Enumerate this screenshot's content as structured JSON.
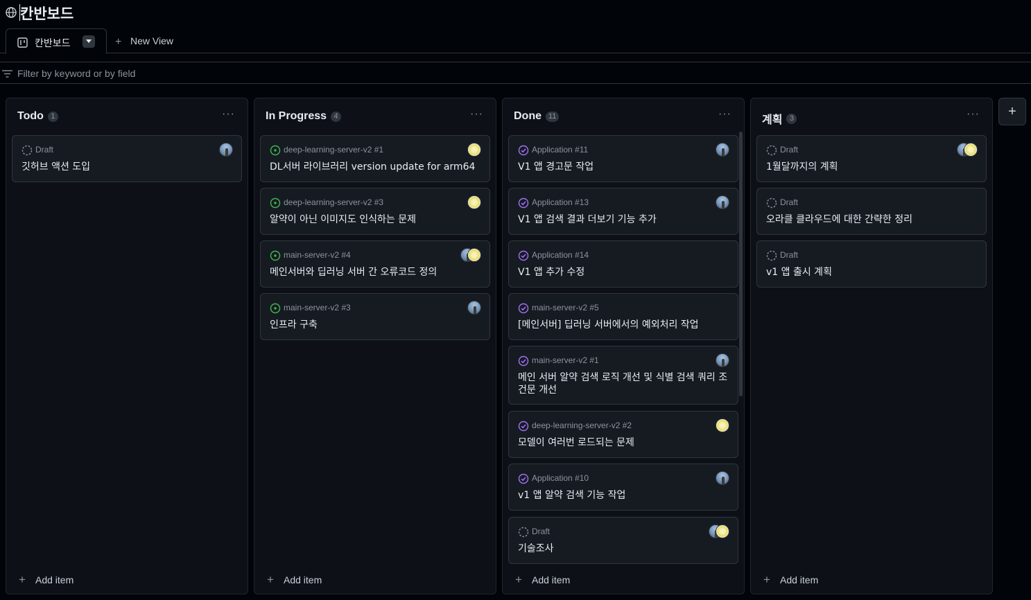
{
  "title": "칸반보드",
  "tabs": {
    "active_label": "칸반보드",
    "new_view_label": "New View"
  },
  "filter": {
    "placeholder": "Filter by keyword or by field"
  },
  "add_item_label": "Add item",
  "columns": [
    {
      "title": "Todo",
      "count": "1",
      "cards": [
        {
          "status": "draft",
          "meta": "Draft",
          "title": "깃허브 액션 도입",
          "avatars": [
            "photo"
          ]
        }
      ]
    },
    {
      "title": "In Progress",
      "count": "4",
      "cards": [
        {
          "status": "open",
          "meta": "deep-learning-server-v2 #1",
          "title": "DL서버 라이브러리 version update for arm64",
          "avatars": [
            "yellow"
          ]
        },
        {
          "status": "open",
          "meta": "deep-learning-server-v2 #3",
          "title": "알약이 아닌 이미지도 인식하는 문제",
          "avatars": [
            "yellow"
          ]
        },
        {
          "status": "open",
          "meta": "main-server-v2 #4",
          "title": "메인서버와 딥러닝 서버 간 오류코드 정의",
          "avatars": [
            "photo",
            "yellow"
          ]
        },
        {
          "status": "open",
          "meta": "main-server-v2 #3",
          "title": "인프라 구축",
          "avatars": [
            "photo"
          ]
        }
      ]
    },
    {
      "title": "Done",
      "count": "11",
      "cards": [
        {
          "status": "done",
          "meta": "Application #11",
          "title": "V1 앱 경고문 작업",
          "avatars": [
            "photo"
          ]
        },
        {
          "status": "done",
          "meta": "Application #13",
          "title": "V1 앱 검색 결과 더보기 기능 추가",
          "avatars": [
            "photo"
          ]
        },
        {
          "status": "done",
          "meta": "Application #14",
          "title": "V1 앱 추가 수정",
          "avatars": []
        },
        {
          "status": "done",
          "meta": "main-server-v2 #5",
          "title": "[메인서버] 딥러닝 서버에서의 예외처리 작업",
          "avatars": []
        },
        {
          "status": "done",
          "meta": "main-server-v2 #1",
          "title": "메인 서버 알약 검색 로직 개선 및 식별 검색 쿼리 조건문 개선",
          "avatars": [
            "photo"
          ]
        },
        {
          "status": "done",
          "meta": "deep-learning-server-v2 #2",
          "title": "모델이 여러번 로드되는 문제",
          "avatars": [
            "yellow"
          ]
        },
        {
          "status": "done",
          "meta": "Application #10",
          "title": "v1 앱 알약 검색 기능 작업",
          "avatars": [
            "photo"
          ]
        },
        {
          "status": "draft",
          "meta": "Draft",
          "title": "기술조사",
          "avatars": [
            "photo",
            "yellow"
          ]
        }
      ]
    },
    {
      "title": "계획",
      "count": "3",
      "cards": [
        {
          "status": "draft",
          "meta": "Draft",
          "title": "1월달까지의 계획",
          "avatars": [
            "photo",
            "yellow"
          ]
        },
        {
          "status": "draft",
          "meta": "Draft",
          "title": "오라클 클라우드에 대한 간략한 정리",
          "avatars": []
        },
        {
          "status": "draft",
          "meta": "Draft",
          "title": "v1 앱 출시 계획",
          "avatars": []
        }
      ]
    }
  ],
  "colors": {
    "background": "#010409",
    "column_bg": "#0d1117",
    "card_bg": "#161b22",
    "border": "#30363d",
    "open_green": "#3fb950",
    "done_purple": "#a371f7",
    "muted": "#8b949e"
  },
  "icons": {
    "globe": "globe-icon",
    "board": "board-icon",
    "filter": "filter-icon",
    "draft": "draft-circle-icon",
    "open": "issue-open-icon",
    "done": "issue-closed-icon"
  }
}
